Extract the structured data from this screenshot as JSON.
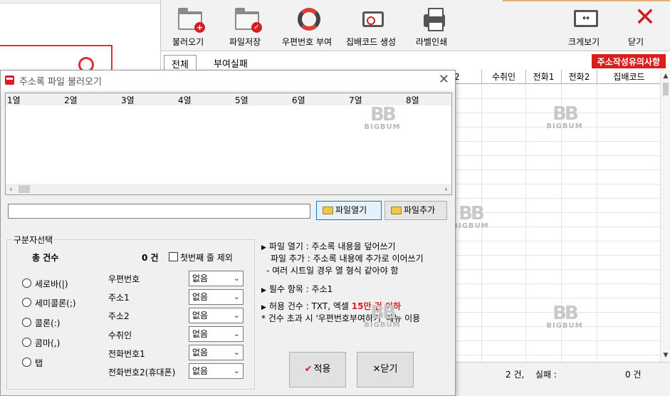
{
  "toolbar": {
    "items": [
      {
        "label": "불러오기",
        "icon": "folder-plus-icon"
      },
      {
        "label": "파일저장",
        "icon": "folder-check-icon"
      },
      {
        "label": "우편번호 부여",
        "icon": "refresh-icon"
      },
      {
        "label": "집배코드 생성",
        "icon": "zipcode-icon"
      },
      {
        "label": "라벨인쇄",
        "icon": "printer-icon"
      },
      {
        "label": "크게보기",
        "icon": "expand-icon"
      },
      {
        "label": "닫기",
        "icon": "close-icon"
      }
    ]
  },
  "tabs": {
    "all": "전체",
    "failed": "부여실패"
  },
  "warning_button": "주소작성유의사항",
  "grid": {
    "columns": [
      "2",
      "수취인",
      "전화1",
      "전화2",
      "집배코드"
    ]
  },
  "watermark": {
    "logo": "BB",
    "text": "BIGBUM"
  },
  "status": {
    "count": "2 건,",
    "fail_label": "실패 :",
    "fail_count": "0 건"
  },
  "dialog": {
    "title": "주소록 파일 불러오기",
    "columns": [
      "1열",
      "2열",
      "3열",
      "4열",
      "5열",
      "6열",
      "7열",
      "8열"
    ],
    "path_value": "",
    "open_button": "파일열기",
    "add_button": "파일추가",
    "group_title": "구분자선택",
    "total_label": "총 건수",
    "total_value": "0 건",
    "skip_first_label": "첫번째 줄 제외",
    "delimiters": [
      "세로바(|)",
      "세미콜론(;)",
      "콜론(:)",
      "콤마(,)",
      "탭"
    ],
    "fields": [
      {
        "label": "우편번호",
        "value": "없음"
      },
      {
        "label": "주소1",
        "value": "없음"
      },
      {
        "label": "주소2",
        "value": "없음"
      },
      {
        "label": "수취인",
        "value": "없음"
      },
      {
        "label": "전화번호1",
        "value": "없음"
      },
      {
        "label": "전화번호2(휴대폰)",
        "value": "없음"
      }
    ],
    "info": {
      "line1": "파일 열기 : 주소록 내용을 덮어쓰기",
      "line2": "파일 추가 : 주소록 내용에 추가로 이어쓰기",
      "line3": "- 여러 시트일 경우 열 형식 같아야 함",
      "line4": "필수 항목 : 주소1",
      "line5_prefix": "허용 건수 : TXT, 엑셀 ",
      "line5_red": "15만 건 이하",
      "line6": "* 건수 초과 시 '우편번호부여하기' 메뉴 이용"
    },
    "apply_button": "적용",
    "close_button": "닫기"
  }
}
